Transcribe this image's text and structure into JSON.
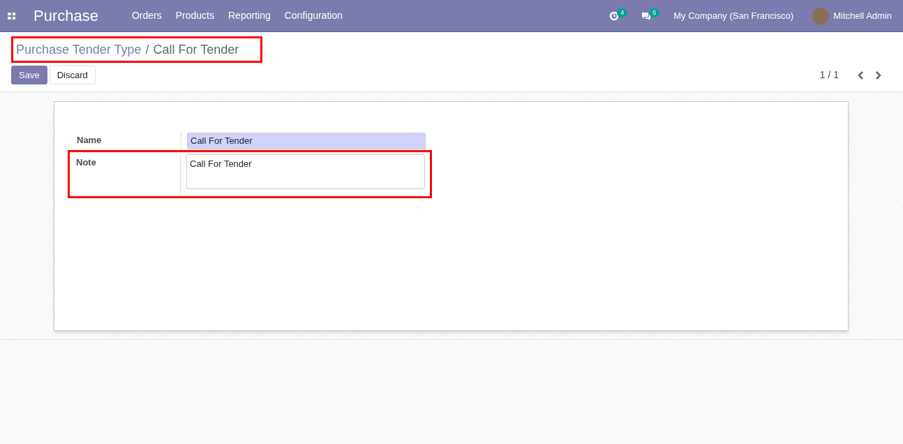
{
  "navbar": {
    "app_name": "Purchase",
    "menu": [
      "Orders",
      "Products",
      "Reporting",
      "Configuration"
    ],
    "activity_count": "4",
    "message_count": "5",
    "company": "My Company (San Francisco)",
    "user": "Mitchell Admin"
  },
  "breadcrumb": {
    "parent": "Purchase Tender Type",
    "separator": "/",
    "current": "Call For Tender",
    "highlighted": true
  },
  "buttons": [
    {
      "label": "Save",
      "kind": "primary"
    },
    {
      "label": "Discard",
      "kind": "secondary"
    }
  ],
  "pager": "1 / 1",
  "form": {
    "fields": [
      {
        "label": "Name",
        "value": "Call For Tender",
        "kind": "input",
        "required": true,
        "highlighted": false
      },
      {
        "label": "Note",
        "value": "Call For Tender",
        "kind": "textarea",
        "required": false,
        "highlighted": true
      }
    ]
  }
}
